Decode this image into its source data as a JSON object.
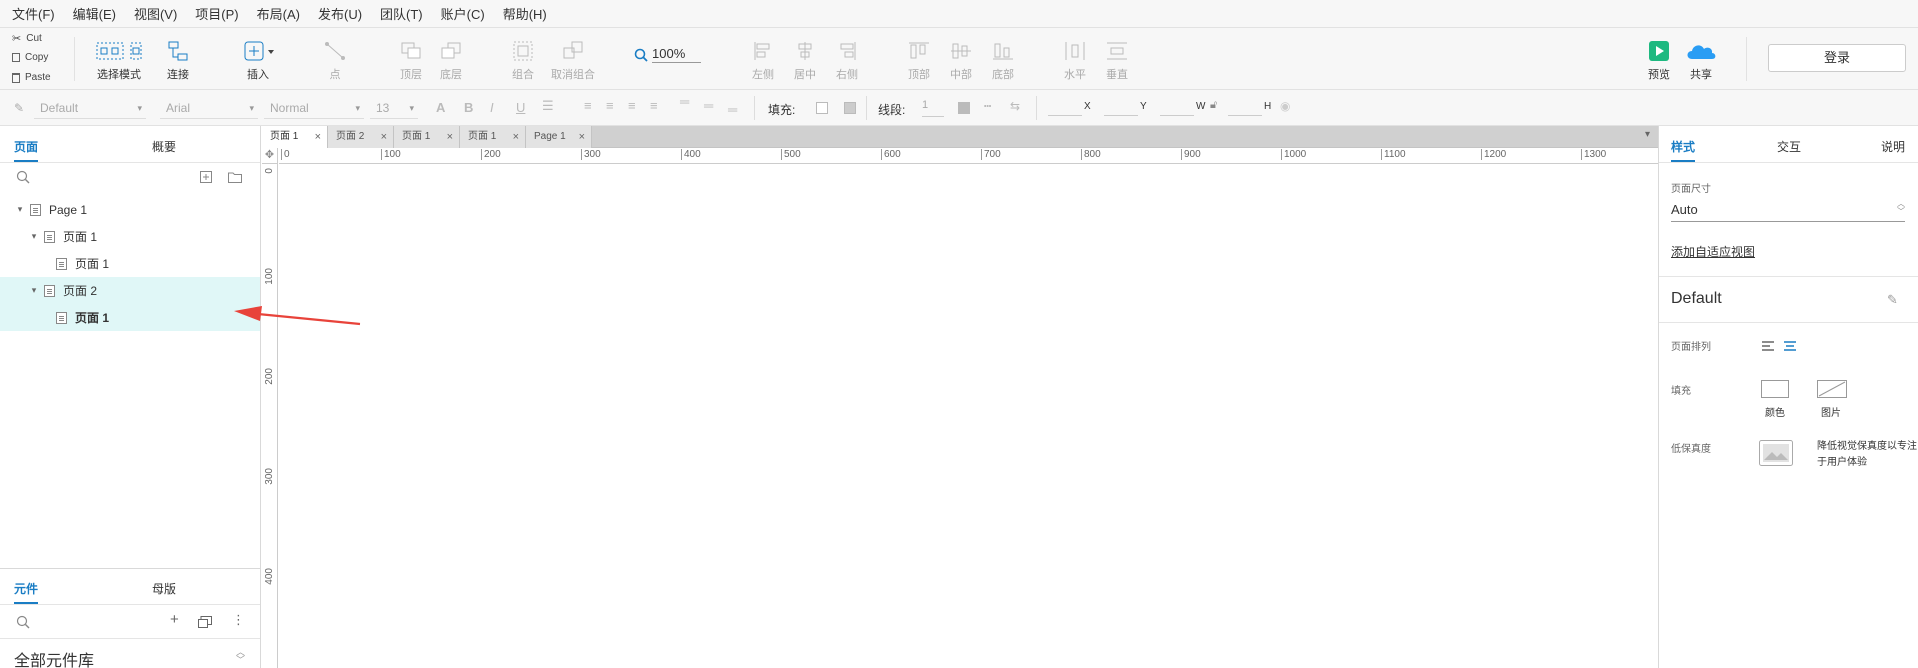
{
  "menu": [
    "文件(F)",
    "编辑(E)",
    "视图(V)",
    "项目(P)",
    "布局(A)",
    "发布(U)",
    "团队(T)",
    "账户(C)",
    "帮助(H)"
  ],
  "clipboard": {
    "cut": "Cut",
    "copy": "Copy",
    "paste": "Paste"
  },
  "toolbar": {
    "select_mode": "选择模式",
    "connect": "连接",
    "insert": "插入",
    "point": "点",
    "top": "顶层",
    "bottom": "底层",
    "group": "组合",
    "ungroup": "取消组合",
    "zoom": "100%",
    "align_left": "左侧",
    "align_center": "居中",
    "align_right": "右侧",
    "align_top": "顶部",
    "align_middle": "中部",
    "align_bottom": "底部",
    "dist_h": "水平",
    "dist_v": "垂直",
    "preview": "预览",
    "share": "共享",
    "login": "登录"
  },
  "format": {
    "style": "Default",
    "font": "Arial",
    "weight": "Normal",
    "size": "13",
    "fill_label": "填充:",
    "line_label": "线段:",
    "line_value": "1",
    "x": "X",
    "y": "Y",
    "w": "W",
    "h": "H"
  },
  "left": {
    "tab_pages": "页面",
    "tab_outline": "概要",
    "tree": [
      {
        "label": "Page 1",
        "level": 0,
        "caret": true,
        "bold": false,
        "selected": false
      },
      {
        "label": "页面 1",
        "level": 1,
        "caret": true,
        "bold": false,
        "selected": false
      },
      {
        "label": "页面 1",
        "level": 2,
        "caret": false,
        "bold": false,
        "selected": false
      },
      {
        "label": "页面 2",
        "level": 1,
        "caret": true,
        "bold": false,
        "selected": true
      },
      {
        "label": "页面 1",
        "level": 2,
        "caret": false,
        "bold": true,
        "selected": true
      }
    ],
    "tab_widgets": "元件",
    "tab_masters": "母版",
    "library": "全部元件库"
  },
  "doc_tabs": [
    "页面 1",
    "页面 2",
    "页面 1",
    "页面 1",
    "Page 1"
  ],
  "ruler": {
    "h": [
      "0",
      "100",
      "200",
      "300",
      "400",
      "500",
      "600",
      "700",
      "800",
      "900",
      "1000",
      "1100",
      "1200",
      "1300"
    ],
    "v": [
      "0",
      "100",
      "200",
      "300",
      "400"
    ]
  },
  "right": {
    "tab_style": "样式",
    "tab_interact": "交互",
    "tab_notes": "说明",
    "page_size_label": "页面尺寸",
    "page_size_value": "Auto",
    "adaptive_link": "添加自适应视图",
    "style_name": "Default",
    "arrange_label": "页面排列",
    "fill_label": "填充",
    "fill_color": "颜色",
    "fill_image": "图片",
    "lowfi_label": "低保真度",
    "lowfi_desc_1": "降低视觉保真度以专注",
    "lowfi_desc_2": "于用户体验"
  },
  "colors": {
    "accent": "#1a7dc4",
    "selection": "#e0f7f7",
    "arrow": "#e8433a",
    "preview": "#1eb980",
    "cloud": "#2a9df4"
  }
}
